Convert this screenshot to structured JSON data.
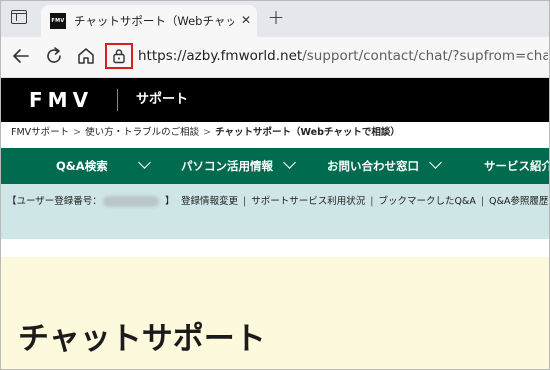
{
  "browser": {
    "tab": {
      "favicon_text": "FMV",
      "title": "チャットサポート（Webチャットで相談）",
      "close_glyph": "✕"
    },
    "new_tab_glyph": "+",
    "url": {
      "host": "https://azby.fmworld.net",
      "path": "/support/contact/chat/?supfrom=chat_line_faq"
    }
  },
  "site": {
    "logo": "FMV",
    "section": "サポート"
  },
  "breadcrumb": {
    "items": [
      "FMVサポート",
      "使い方・トラブルのご相談"
    ],
    "current": "チャットサポート（Webチャットで相談）",
    "separator": ">"
  },
  "nav": {
    "items": [
      "Q&A検索",
      "パソコン活用情報",
      "お問い合わせ窓口",
      "サービス紹介"
    ]
  },
  "user_bar": {
    "label": "【ユーザー登録番号：",
    "bracket_close": "】",
    "links": [
      "登録情報変更",
      "サポートサービス利用状況",
      "ブックマークしたQ&A",
      "Q&A参照履歴"
    ],
    "separator": "|"
  },
  "content": {
    "title": "チャットサポート"
  },
  "colors": {
    "header_bg": "#000000",
    "nav_bg": "#006b4e",
    "user_bar_bg": "#cfe6e6",
    "content_bg": "#fdf9dd",
    "highlight_box": "#d81e1e"
  }
}
